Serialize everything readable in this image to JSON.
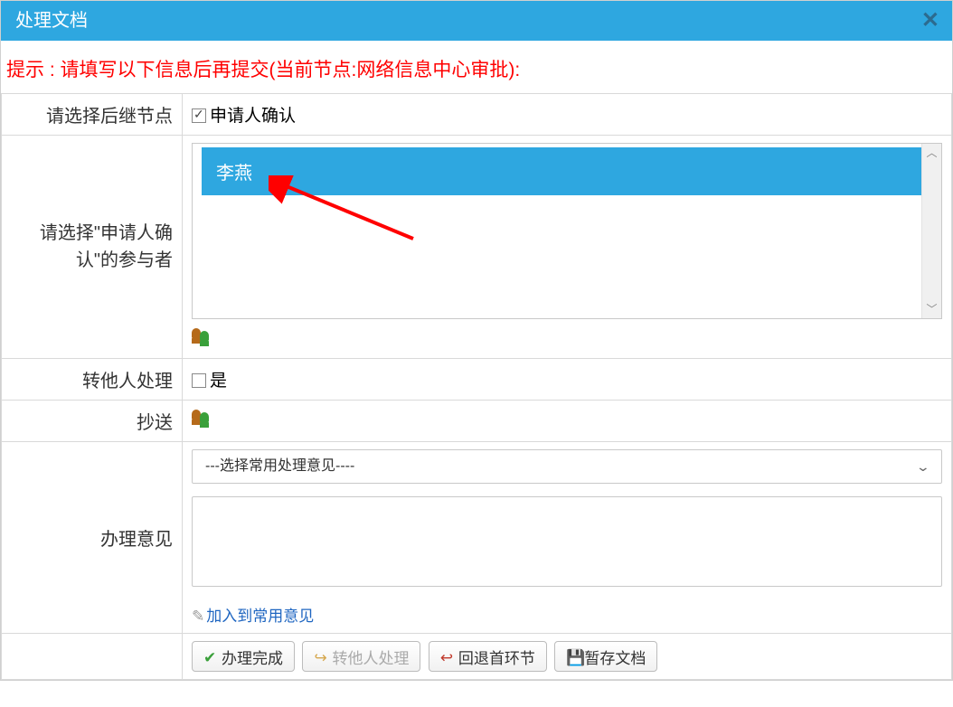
{
  "dialog": {
    "title": "处理文档",
    "hint": "提示 : 请填写以下信息后再提交(当前节点:网络信息中心审批):"
  },
  "rows": {
    "next_node_label": "请选择后继节点",
    "next_node_option": "申请人确认",
    "participants_label": "请选择\"申请人确认\"的参与者",
    "participant_item": "李燕",
    "forward_label": "转他人处理",
    "forward_option": "是",
    "cc_label": "抄送",
    "opinion_label": "办理意见",
    "opinion_select_placeholder": "---选择常用处理意见----",
    "add_common_opinion": "加入到常用意见"
  },
  "buttons": {
    "complete": "办理完成",
    "forward": "转他人处理",
    "rollback": "回退首环节",
    "save_draft": "暂存文档"
  }
}
